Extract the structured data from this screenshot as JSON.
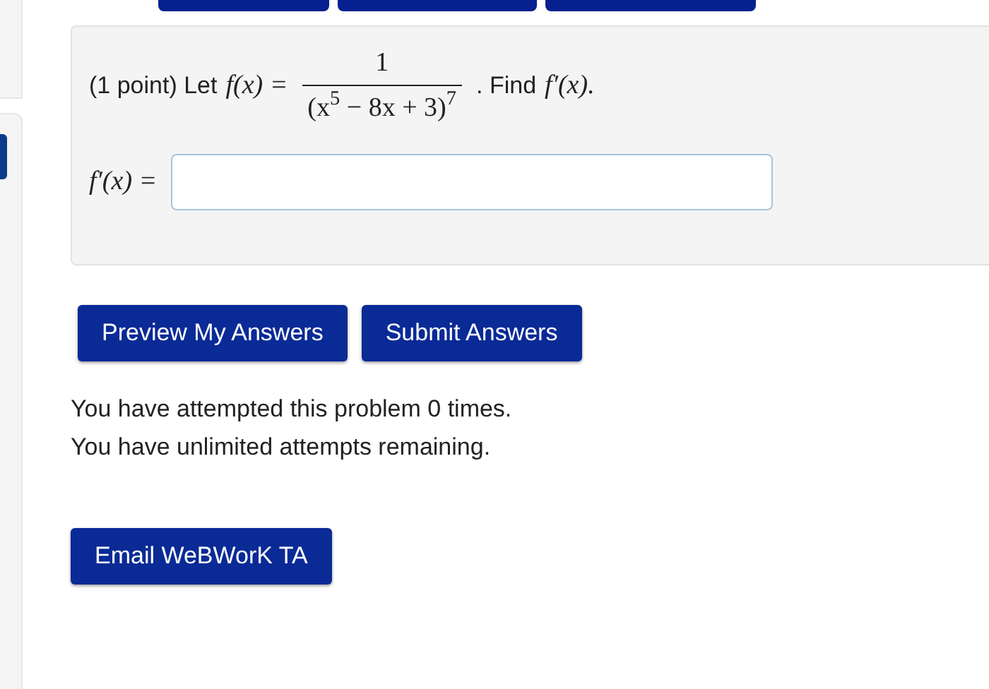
{
  "problem": {
    "prefix": "(1 point) Let",
    "lhs": "f(x) =",
    "numerator": "1",
    "denominator": "(x$^{5}$ − 8x + 3)$^{7}$",
    "suffix_text": ". Find",
    "suffix_math": "f′(x)."
  },
  "answer": {
    "label": "f′(x) ="
  },
  "buttons": [
    {
      "label": "Preview My Answers"
    },
    {
      "label": "Submit Answers"
    }
  ],
  "messages": [
    "You have attempted this problem 0 times.",
    "You have unlimited attempts remaining."
  ],
  "email_button": {
    "label": "Email WeBWorK TA"
  }
}
